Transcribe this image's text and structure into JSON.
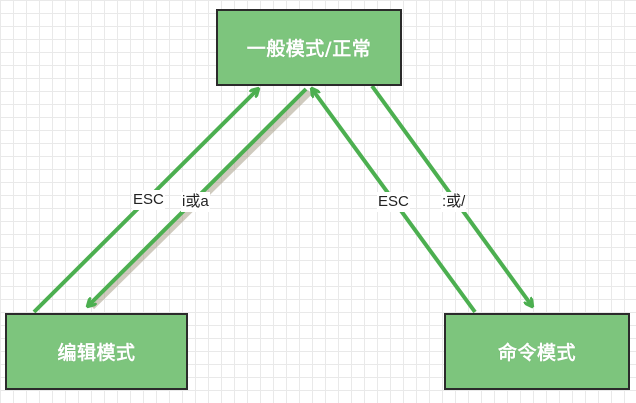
{
  "diagram": {
    "nodes": {
      "normal": "一般模式/正常",
      "edit": "编辑模式",
      "command": "命令模式"
    },
    "edges": [
      {
        "from": "编辑模式",
        "to": "一般模式/正常",
        "label": "ESC"
      },
      {
        "from": "一般模式/正常",
        "to": "编辑模式",
        "label": "i或a"
      },
      {
        "from": "命令模式",
        "to": "一般模式/正常",
        "label": "ESC"
      },
      {
        "from": "一般模式/正常",
        "to": "命令模式",
        "label": ":或/"
      }
    ],
    "colors": {
      "node_fill": "#7dc57d",
      "node_border": "#2b2b2b",
      "arrow": "#4caf50"
    }
  }
}
